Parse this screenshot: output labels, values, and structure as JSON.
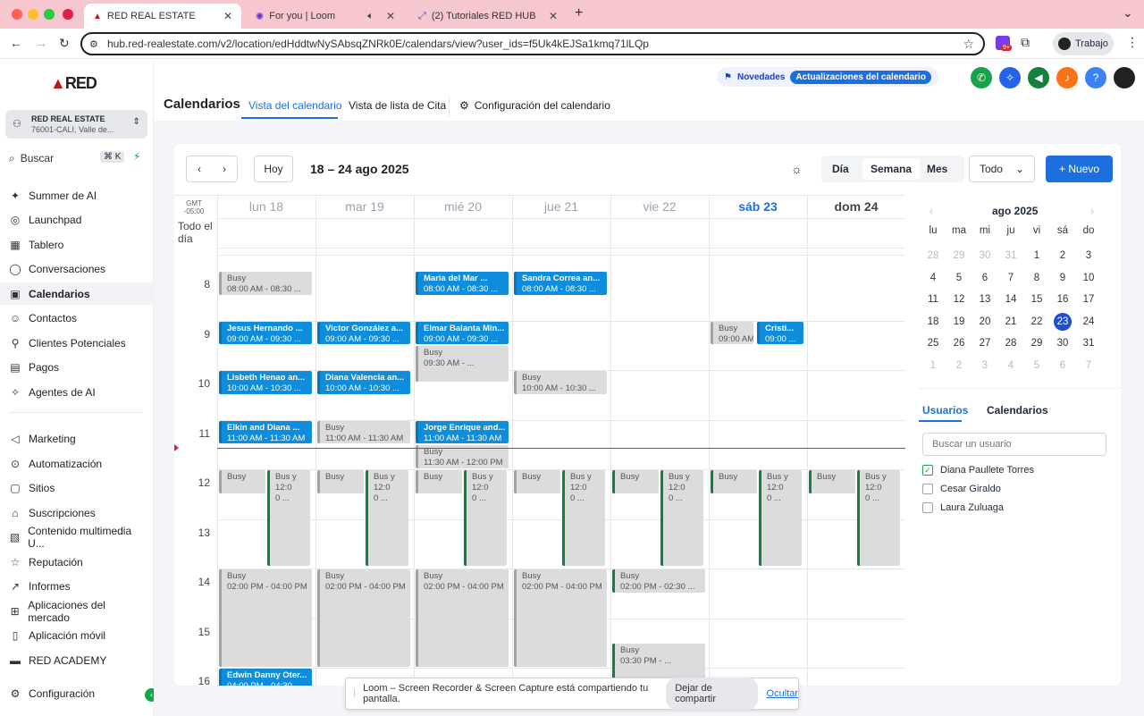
{
  "browser": {
    "tabs": [
      {
        "title": "RED REAL ESTATE"
      },
      {
        "title": "For you | Loom"
      },
      {
        "title": "(2) Tutoriales RED HUB"
      }
    ],
    "url": "hub.red-realestate.com/v2/location/edHddtwNySAbsqZNRk0E/calendars/view?user_ids=f5Uk4kEJSa1kmq71lLQp",
    "profile": "Trabajo",
    "badge": "9+"
  },
  "sidebar": {
    "account_name": "RED REAL ESTATE",
    "account_sub": "76001-CALI, Valle de...",
    "search_label": "Buscar",
    "search_shortcut": "⌘ K",
    "items": [
      {
        "label": "Summer de AI",
        "icon": "sparkle-icon"
      },
      {
        "label": "Launchpad",
        "icon": "rocket-icon"
      },
      {
        "label": "Tablero",
        "icon": "dashboard-icon"
      },
      {
        "label": "Conversaciones",
        "icon": "chat-icon"
      },
      {
        "label": "Calendarios",
        "icon": "calendar-icon"
      },
      {
        "label": "Contactos",
        "icon": "contacts-icon"
      },
      {
        "label": "Clientes Potenciales",
        "icon": "funnel-icon"
      },
      {
        "label": "Pagos",
        "icon": "payments-icon"
      },
      {
        "label": "Agentes de AI",
        "icon": "ai-agent-icon"
      },
      {
        "label": "Marketing",
        "icon": "megaphone-icon"
      },
      {
        "label": "Automatización",
        "icon": "automation-icon"
      },
      {
        "label": "Sitios",
        "icon": "sites-icon"
      },
      {
        "label": "Suscripciones",
        "icon": "subscriptions-icon"
      },
      {
        "label": "Contenido multimedia U...",
        "icon": "media-icon"
      },
      {
        "label": "Reputación",
        "icon": "star-icon"
      },
      {
        "label": "Informes",
        "icon": "chart-icon"
      },
      {
        "label": "Aplicaciones del mercado",
        "icon": "apps-icon"
      },
      {
        "label": "Aplicación móvil",
        "icon": "mobile-icon"
      },
      {
        "label": "RED ACADEMY",
        "icon": "academy-icon"
      },
      {
        "label": "Configuración",
        "icon": "gear-icon"
      }
    ]
  },
  "header": {
    "title": "Calendarios",
    "tabs": [
      "Vista del calendario",
      "Vista de lista de Cita",
      "Configuración del calendario"
    ],
    "novedades": "Novedades",
    "update_badge": "Actualizaciones del calendario"
  },
  "calendar": {
    "range": "18 – 24 ago 2025",
    "today": "Hoy",
    "views": [
      "Día",
      "Semana",
      "Mes"
    ],
    "filter": "Todo",
    "new_button": "+ Nuevo",
    "timezone": "GMT -05:00",
    "all_day": "Todo el día",
    "days": [
      "lun 18",
      "mar 19",
      "mié 20",
      "jue 21",
      "vie 22",
      "sáb 23",
      "dom 24"
    ],
    "hours": [
      "8",
      "9",
      "10",
      "11",
      "12",
      "13",
      "14",
      "15",
      "16"
    ],
    "events": [
      {
        "col": 0,
        "row": 0,
        "h": 1,
        "kind": "gray",
        "title": "Busy",
        "time": "08:00 AM - 08:30 ..."
      },
      {
        "col": 2,
        "row": 0,
        "h": 1,
        "kind": "blue",
        "title": "Maria del Mar ...",
        "time": "08:00 AM - 08:30 ..."
      },
      {
        "col": 3,
        "row": 0,
        "h": 1,
        "kind": "blue",
        "title": "Sandra Correa an...",
        "time": "08:00 AM - 08:30 ..."
      },
      {
        "col": 0,
        "row": 1,
        "h": 1,
        "kind": "blue",
        "title": "Jesus Hernando ...",
        "time": "09:00 AM - 09:30 ..."
      },
      {
        "col": 1,
        "row": 1,
        "h": 1,
        "kind": "blue",
        "title": "Victor González a...",
        "time": "09:00 AM - 09:30 ..."
      },
      {
        "col": 2,
        "row": 1,
        "h": 1,
        "kind": "blue",
        "title": "Elmar Balanta Min...",
        "time": "09:00 AM - 09:30 ..."
      },
      {
        "col": 2,
        "row": 1.5,
        "h": 1.5,
        "kind": "gray",
        "title": "Busy",
        "time": "09:30 AM - ..."
      },
      {
        "col": 5,
        "row": 1,
        "h": 1,
        "kind": "gray",
        "title": "Busy",
        "time": "09:00 AM",
        "half": "left"
      },
      {
        "col": 5,
        "row": 1,
        "h": 1,
        "kind": "blue",
        "title": "Cristi...",
        "time": "09:00 ...",
        "half": "right"
      },
      {
        "col": 0,
        "row": 2,
        "h": 1,
        "kind": "blue",
        "title": "Lisbeth Henao an...",
        "time": "10:00 AM - 10:30 ..."
      },
      {
        "col": 1,
        "row": 2,
        "h": 1,
        "kind": "blue",
        "title": "Diana Valencia an...",
        "time": "10:00 AM - 10:30 ..."
      },
      {
        "col": 3,
        "row": 2,
        "h": 1,
        "kind": "gray",
        "title": "Busy",
        "time": "10:00 AM - 10:30 ..."
      },
      {
        "col": 0,
        "row": 3,
        "h": 1,
        "kind": "blue",
        "title": "Elkin and Diana ...",
        "time": "11:00 AM - 11:30 AM"
      },
      {
        "col": 1,
        "row": 3,
        "h": 1,
        "kind": "gray",
        "title": "Busy",
        "time": "11:00 AM - 11:30 AM"
      },
      {
        "col": 2,
        "row": 3,
        "h": 1,
        "kind": "blue",
        "title": "Jorge Enrique and...",
        "time": "11:00 AM - 11:30 AM"
      },
      {
        "col": 2,
        "row": 3.5,
        "h": 1,
        "kind": "gray",
        "title": "Busy",
        "time": "11:30 AM - 12:00 PM"
      },
      {
        "col": 0,
        "row": 6,
        "h": 4,
        "kind": "gray",
        "title": "Busy",
        "time": "02:00 PM - 04:00 PM"
      },
      {
        "col": 1,
        "row": 6,
        "h": 4,
        "kind": "gray",
        "title": "Busy",
        "time": "02:00 PM - 04:00 PM"
      },
      {
        "col": 2,
        "row": 6,
        "h": 4,
        "kind": "gray",
        "title": "Busy",
        "time": "02:00 PM - 04:00 PM"
      },
      {
        "col": 3,
        "row": 6,
        "h": 4,
        "kind": "gray",
        "title": "Busy",
        "time": "02:00 PM - 04:00 PM"
      },
      {
        "col": 4,
        "row": 6,
        "h": 1,
        "kind": "green",
        "title": "Busy",
        "time": "02:00 PM - 02:30 ..."
      },
      {
        "col": 4,
        "row": 7.5,
        "h": 1.5,
        "kind": "green",
        "title": "Busy",
        "time": "03:30 PM - ..."
      },
      {
        "col": 0,
        "row": 8,
        "h": 1,
        "kind": "blue",
        "title": "Edwin Danny Oter...",
        "time": "04:00 PM - 04:30 ..."
      }
    ],
    "noon_block": {
      "title": "Busy",
      "side_title": "Bus y",
      "side_time": "12:0 0 ..."
    }
  },
  "minical": {
    "month": "ago 2025",
    "weekdays": [
      "lu",
      "ma",
      "mi",
      "ju",
      "vi",
      "sá",
      "do"
    ],
    "weeks": [
      [
        "28",
        "29",
        "30",
        "31",
        "1",
        "2",
        "3"
      ],
      [
        "4",
        "5",
        "6",
        "7",
        "8",
        "9",
        "10"
      ],
      [
        "11",
        "12",
        "13",
        "14",
        "15",
        "16",
        "17"
      ],
      [
        "18",
        "19",
        "20",
        "21",
        "22",
        "23",
        "24"
      ],
      [
        "25",
        "26",
        "27",
        "28",
        "29",
        "30",
        "31"
      ],
      [
        "1",
        "2",
        "3",
        "4",
        "5",
        "6",
        "7"
      ]
    ],
    "selected": "23"
  },
  "users_panel": {
    "tabs": [
      "Usuarios",
      "Calendarios"
    ],
    "search_placeholder": "Buscar un usuario",
    "users": [
      {
        "name": "Diana Paullete Torres",
        "checked": true
      },
      {
        "name": "Cesar Giraldo",
        "checked": false
      },
      {
        "name": "Laura Zuluaga",
        "checked": false
      }
    ]
  },
  "toast": {
    "message": "Loom – Screen Recorder & Screen Capture está compartiendo tu pantalla.",
    "stop": "Dejar de compartir",
    "hide": "Ocultar"
  },
  "colors": {
    "accent": "#1d6fe0",
    "event_blue": "#0d8ddb",
    "now_line": "#e11d48"
  }
}
